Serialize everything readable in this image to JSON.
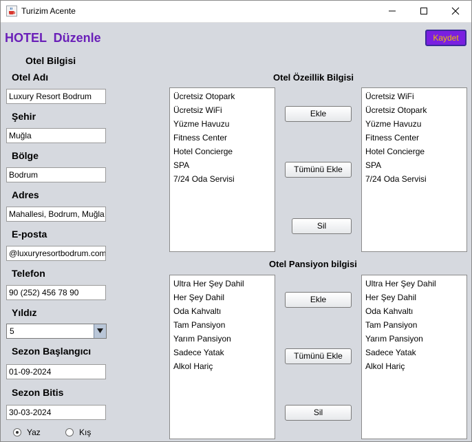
{
  "window": {
    "title": "Turizim Acente"
  },
  "header": {
    "title": "HOTEL  Düzenle",
    "save_label": "Kaydet"
  },
  "form": {
    "section_title": "Otel Bilgisi",
    "hotel_name_label": "Otel Adı",
    "hotel_name_value": "Luxury Resort Bodrum",
    "city_label": "Şehir",
    "city_value": "Muğla",
    "region_label": "Bölge",
    "region_value": "Bodrum",
    "address_label": "Adres",
    "address_value": "Mahallesi, Bodrum, Muğla",
    "email_label": "E-posta",
    "email_value": "@luxuryresortbodrum.com",
    "phone_label": "Telefon",
    "phone_value": "90 (252) 456 78 90",
    "stars_label": "Yıldız",
    "stars_value": "5",
    "season_start_label": "Sezon Başlangıcı",
    "season_start_value": "01-09-2024",
    "season_end_label": "Sezon Bitis",
    "season_end_value": "30-03-2024",
    "season_options": [
      "Yaz",
      "Kış"
    ],
    "season_selected": "Yaz"
  },
  "features": {
    "title": "Otel Özeillik Bilgisi",
    "available": [
      "Ücretsiz Otopark",
      "Ücretsiz WiFi",
      "Yüzme Havuzu",
      "Fitness Center",
      "Hotel Concierge",
      "SPA",
      "7/24 Oda Servisi"
    ],
    "selected": [
      "Ücretsiz WiFi",
      "Ücretsiz Otopark",
      "Yüzme Havuzu",
      "Fitness Center",
      "Hotel Concierge",
      "SPA",
      "7/24 Oda Servisi"
    ],
    "add_label": "Ekle",
    "add_all_label": "Tümünü Ekle",
    "remove_label": "Sil"
  },
  "pension": {
    "title": "Otel Pansiyon bilgisi",
    "available": [
      "Ultra Her Şey Dahil",
      "Her Şey Dahil",
      "Oda Kahvaltı",
      "Tam Pansiyon",
      "Yarım Pansiyon",
      "Sadece Yatak",
      "Alkol Hariç"
    ],
    "selected": [
      "Ultra Her Şey Dahil",
      "Her Şey Dahil",
      "Oda Kahvaltı",
      "Tam Pansiyon",
      "Yarım Pansiyon",
      "Sadece Yatak",
      "Alkol Hariç"
    ],
    "add_label": "Ekle",
    "add_all_label": "Tümünü Ekle",
    "remove_label": "Sil"
  },
  "icons": {
    "app": "java-coffee-cup-icon",
    "minimize": "minimize-icon",
    "maximize": "maximize-icon",
    "close": "close-icon",
    "dropdown": "chevron-down-icon"
  },
  "colors": {
    "heading": "#6a1fb8",
    "save_bg": "#7a1fe0",
    "save_text": "#f0c000",
    "window_bg": "#d6d9df"
  }
}
